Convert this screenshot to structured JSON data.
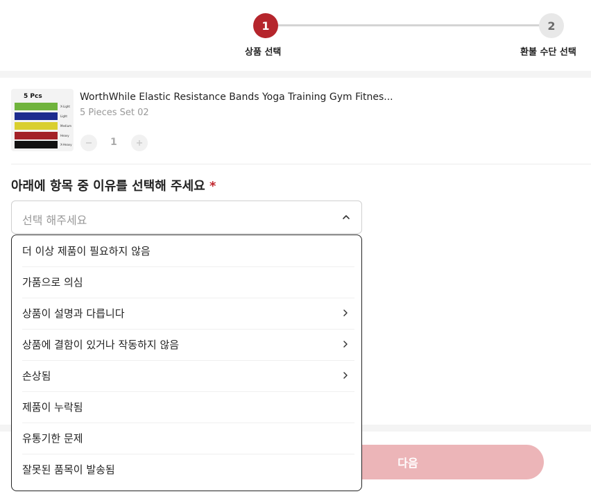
{
  "stepper": {
    "steps": [
      {
        "number": "1",
        "label": "상품 선택"
      },
      {
        "number": "2",
        "label": "환불 수단 선택"
      }
    ]
  },
  "product": {
    "thumbnail_title": "5 Pcs",
    "thumbnail_levels": [
      "X-Light",
      "Light",
      "Medium",
      "Heavy",
      "X-Heavy"
    ],
    "thumbnail_colors": [
      "#6fb33c",
      "#1d2c8e",
      "#d9cf2f",
      "#a32127",
      "#111111"
    ],
    "name": "WorthWhile Elastic Resistance Bands Yoga Training Gym Fitnes...",
    "option": "5 Pieces Set 02",
    "quantity": "1",
    "minus_icon": "minus-icon",
    "plus_icon": "plus-icon"
  },
  "reason": {
    "title": "아래에 항목 중 이유를 선택해 주세요",
    "required_mark": "*",
    "placeholder": "선택 해주세요",
    "options": [
      {
        "label": "더 이상 제품이 필요하지 않음",
        "has_submenu": false
      },
      {
        "label": "가품으로 의심",
        "has_submenu": false
      },
      {
        "label": "상품이 설명과 다릅니다",
        "has_submenu": true
      },
      {
        "label": "상품에 결함이 있거나 작동하지 않음",
        "has_submenu": true
      },
      {
        "label": "손상됨",
        "has_submenu": true
      },
      {
        "label": "제품이 누락됨",
        "has_submenu": false
      },
      {
        "label": "유통기한 문제",
        "has_submenu": false
      },
      {
        "label": "잘못된 품목이 발송됨",
        "has_submenu": false
      }
    ]
  },
  "footer": {
    "next_label": "다음"
  },
  "colors": {
    "accent": "#b5252c",
    "next_disabled": "#ecb5b8"
  }
}
